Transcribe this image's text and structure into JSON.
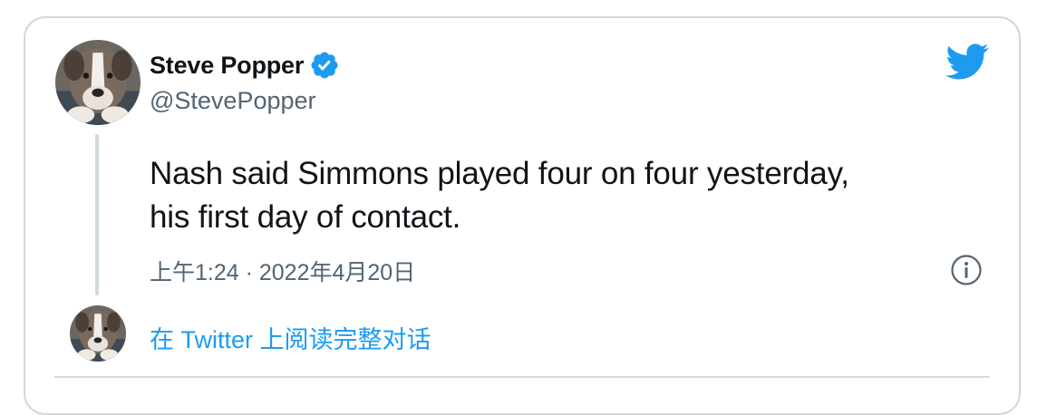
{
  "author": {
    "display_name": "Steve Popper",
    "handle": "@StevePopper",
    "verified": true,
    "avatar_icon": "dog-avatar-icon"
  },
  "tweet": {
    "text": "Nash said Simmons played four on four yesterday,\nhis first day of contact.",
    "timestamp": "上午1:24 · 2022年4月20日"
  },
  "actions": {
    "read_full_conversation": "在 Twitter 上阅读完整对话"
  },
  "icons": {
    "brand": "twitter-bird-icon",
    "verified": "verified-badge-icon",
    "info": "info-icon"
  },
  "colors": {
    "accent": "#1d9bf0",
    "text_primary": "#0f1419",
    "text_secondary": "#536471",
    "border": "#cfd9de"
  }
}
